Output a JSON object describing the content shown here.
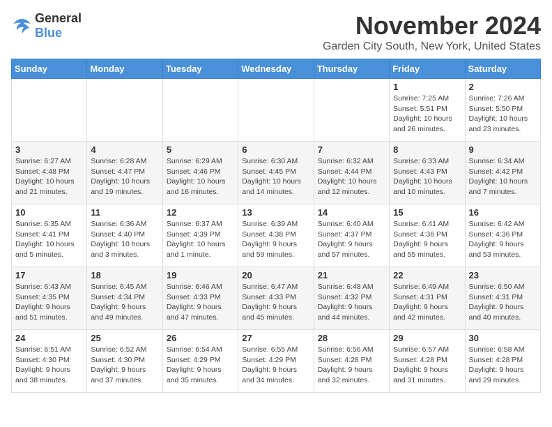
{
  "logo": {
    "general": "General",
    "blue": "Blue"
  },
  "header": {
    "month": "November 2024",
    "location": "Garden City South, New York, United States"
  },
  "weekdays": [
    "Sunday",
    "Monday",
    "Tuesday",
    "Wednesday",
    "Thursday",
    "Friday",
    "Saturday"
  ],
  "weeks": [
    [
      {
        "day": "",
        "info": ""
      },
      {
        "day": "",
        "info": ""
      },
      {
        "day": "",
        "info": ""
      },
      {
        "day": "",
        "info": ""
      },
      {
        "day": "",
        "info": ""
      },
      {
        "day": "1",
        "info": "Sunrise: 7:25 AM\nSunset: 5:51 PM\nDaylight: 10 hours\nand 26 minutes."
      },
      {
        "day": "2",
        "info": "Sunrise: 7:26 AM\nSunset: 5:50 PM\nDaylight: 10 hours\nand 23 minutes."
      }
    ],
    [
      {
        "day": "3",
        "info": "Sunrise: 6:27 AM\nSunset: 4:48 PM\nDaylight: 10 hours\nand 21 minutes."
      },
      {
        "day": "4",
        "info": "Sunrise: 6:28 AM\nSunset: 4:47 PM\nDaylight: 10 hours\nand 19 minutes."
      },
      {
        "day": "5",
        "info": "Sunrise: 6:29 AM\nSunset: 4:46 PM\nDaylight: 10 hours\nand 16 minutes."
      },
      {
        "day": "6",
        "info": "Sunrise: 6:30 AM\nSunset: 4:45 PM\nDaylight: 10 hours\nand 14 minutes."
      },
      {
        "day": "7",
        "info": "Sunrise: 6:32 AM\nSunset: 4:44 PM\nDaylight: 10 hours\nand 12 minutes."
      },
      {
        "day": "8",
        "info": "Sunrise: 6:33 AM\nSunset: 4:43 PM\nDaylight: 10 hours\nand 10 minutes."
      },
      {
        "day": "9",
        "info": "Sunrise: 6:34 AM\nSunset: 4:42 PM\nDaylight: 10 hours\nand 7 minutes."
      }
    ],
    [
      {
        "day": "10",
        "info": "Sunrise: 6:35 AM\nSunset: 4:41 PM\nDaylight: 10 hours\nand 5 minutes."
      },
      {
        "day": "11",
        "info": "Sunrise: 6:36 AM\nSunset: 4:40 PM\nDaylight: 10 hours\nand 3 minutes."
      },
      {
        "day": "12",
        "info": "Sunrise: 6:37 AM\nSunset: 4:39 PM\nDaylight: 10 hours\nand 1 minute."
      },
      {
        "day": "13",
        "info": "Sunrise: 6:39 AM\nSunset: 4:38 PM\nDaylight: 9 hours\nand 59 minutes."
      },
      {
        "day": "14",
        "info": "Sunrise: 6:40 AM\nSunset: 4:37 PM\nDaylight: 9 hours\nand 57 minutes."
      },
      {
        "day": "15",
        "info": "Sunrise: 6:41 AM\nSunset: 4:36 PM\nDaylight: 9 hours\nand 55 minutes."
      },
      {
        "day": "16",
        "info": "Sunrise: 6:42 AM\nSunset: 4:36 PM\nDaylight: 9 hours\nand 53 minutes."
      }
    ],
    [
      {
        "day": "17",
        "info": "Sunrise: 6:43 AM\nSunset: 4:35 PM\nDaylight: 9 hours\nand 51 minutes."
      },
      {
        "day": "18",
        "info": "Sunrise: 6:45 AM\nSunset: 4:34 PM\nDaylight: 9 hours\nand 49 minutes."
      },
      {
        "day": "19",
        "info": "Sunrise: 6:46 AM\nSunset: 4:33 PM\nDaylight: 9 hours\nand 47 minutes."
      },
      {
        "day": "20",
        "info": "Sunrise: 6:47 AM\nSunset: 4:33 PM\nDaylight: 9 hours\nand 45 minutes."
      },
      {
        "day": "21",
        "info": "Sunrise: 6:48 AM\nSunset: 4:32 PM\nDaylight: 9 hours\nand 44 minutes."
      },
      {
        "day": "22",
        "info": "Sunrise: 6:49 AM\nSunset: 4:31 PM\nDaylight: 9 hours\nand 42 minutes."
      },
      {
        "day": "23",
        "info": "Sunrise: 6:50 AM\nSunset: 4:31 PM\nDaylight: 9 hours\nand 40 minutes."
      }
    ],
    [
      {
        "day": "24",
        "info": "Sunrise: 6:51 AM\nSunset: 4:30 PM\nDaylight: 9 hours\nand 38 minutes."
      },
      {
        "day": "25",
        "info": "Sunrise: 6:52 AM\nSunset: 4:30 PM\nDaylight: 9 hours\nand 37 minutes."
      },
      {
        "day": "26",
        "info": "Sunrise: 6:54 AM\nSunset: 4:29 PM\nDaylight: 9 hours\nand 35 minutes."
      },
      {
        "day": "27",
        "info": "Sunrise: 6:55 AM\nSunset: 4:29 PM\nDaylight: 9 hours\nand 34 minutes."
      },
      {
        "day": "28",
        "info": "Sunrise: 6:56 AM\nSunset: 4:28 PM\nDaylight: 9 hours\nand 32 minutes."
      },
      {
        "day": "29",
        "info": "Sunrise: 6:57 AM\nSunset: 4:28 PM\nDaylight: 9 hours\nand 31 minutes."
      },
      {
        "day": "30",
        "info": "Sunrise: 6:58 AM\nSunset: 4:28 PM\nDaylight: 9 hours\nand 29 minutes."
      }
    ]
  ]
}
